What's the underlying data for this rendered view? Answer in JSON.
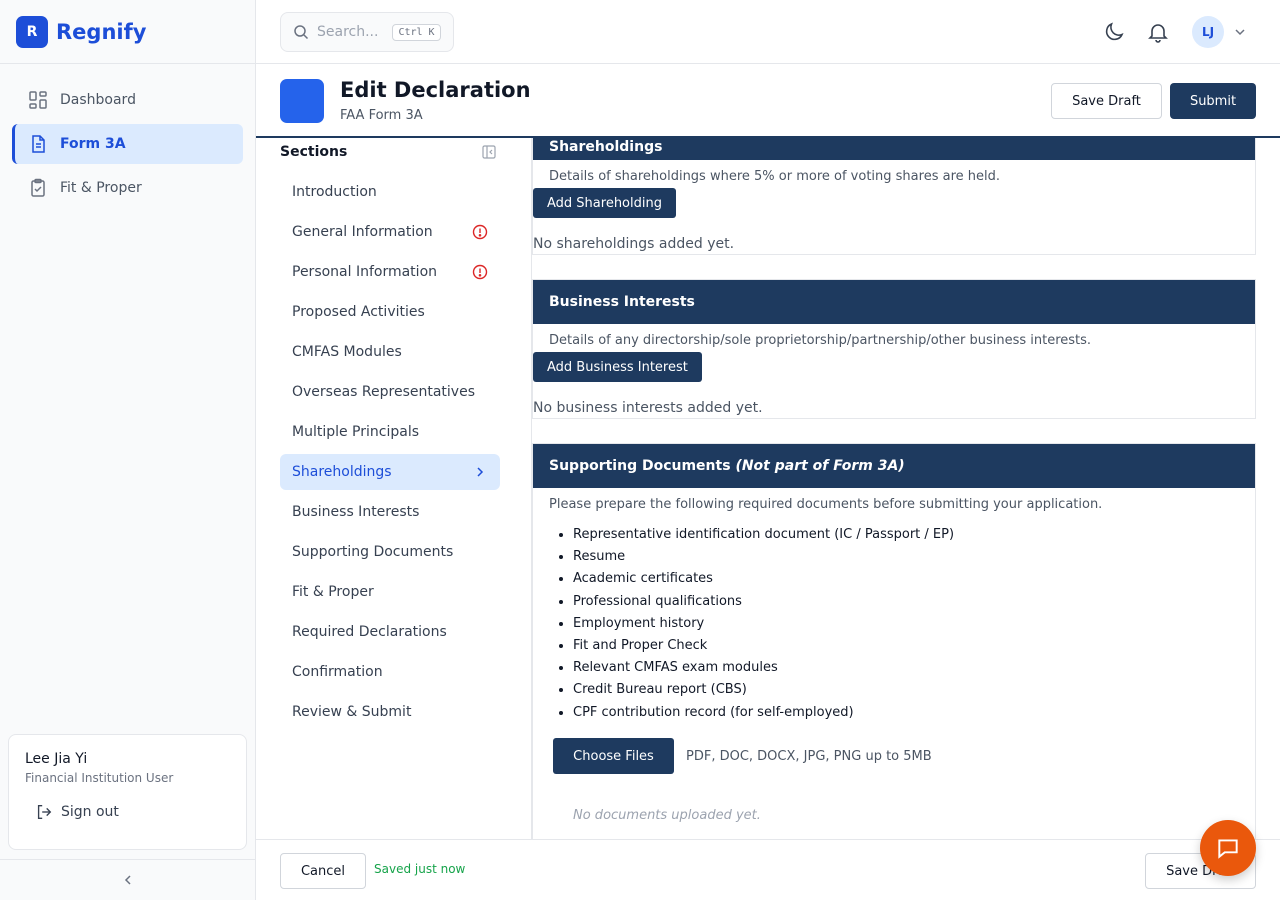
{
  "brand": {
    "logo_letter": "R",
    "name": "Regnify",
    "color": "#1d4ed8"
  },
  "nav": {
    "items": [
      {
        "label": "Dashboard",
        "icon": "dashboard-grid-icon",
        "active": false
      },
      {
        "label": "Form 3A",
        "icon": "document-icon",
        "active": true
      },
      {
        "label": "Fit & Proper",
        "icon": "clipboard-check-icon",
        "active": false
      }
    ]
  },
  "user": {
    "name": "Lee Jia Yi",
    "role": "Financial Institution User",
    "signout_label": "Sign out",
    "initials": "LJ"
  },
  "search": {
    "placeholder": "Search...",
    "shortcut": "Ctrl K"
  },
  "header": {
    "title": "Edit Declaration",
    "subtitle": "FAA Form 3A",
    "save_draft_label": "Save Draft",
    "submit_label": "Submit",
    "accent": "#1e3a5f"
  },
  "sections": {
    "title": "Sections",
    "items": [
      {
        "label": "Introduction",
        "status": ""
      },
      {
        "label": "General Information",
        "status": "error"
      },
      {
        "label": "Personal Information",
        "status": "error"
      },
      {
        "label": "Proposed Activities",
        "status": ""
      },
      {
        "label": "CMFAS Modules",
        "status": ""
      },
      {
        "label": "Overseas Representatives",
        "status": ""
      },
      {
        "label": "Multiple Principals",
        "status": ""
      },
      {
        "label": "Shareholdings",
        "status": "active"
      },
      {
        "label": "Business Interests",
        "status": ""
      },
      {
        "label": "Supporting Documents",
        "status": ""
      },
      {
        "label": "Fit & Proper",
        "status": ""
      },
      {
        "label": "Required Declarations",
        "status": ""
      },
      {
        "label": "Confirmation",
        "status": ""
      },
      {
        "label": "Review & Submit",
        "status": ""
      }
    ]
  },
  "shareholdings": {
    "title": "Shareholdings",
    "description": "Details of shareholdings where 5% or more of voting shares are held.",
    "add_label": "Add Shareholding",
    "empty_text": "No shareholdings added yet."
  },
  "business_interests": {
    "title": "Business Interests",
    "description": "Details of any directorship/sole proprietorship/partnership/other business interests.",
    "add_label": "Add Business Interest",
    "empty_text": "No business interests added yet."
  },
  "supporting_documents": {
    "title": "Supporting Documents",
    "title_note": "(Not part of Form 3A)",
    "description": "Please prepare the following required documents before submitting your application.",
    "documents": [
      "Representative identification document (IC / Passport / EP)",
      "Resume",
      "Academic certificates",
      "Professional qualifications",
      "Employment history",
      "Fit and Proper Check",
      "Relevant CMFAS exam modules",
      "Credit Bureau report (CBS)",
      "CPF contribution record (for self-employed)"
    ],
    "choose_label": "Choose Files",
    "upload_hint": "PDF, DOC, DOCX, JPG, PNG up to 5MB",
    "empty_text": "No documents uploaded yet."
  },
  "footer": {
    "cancel_label": "Cancel",
    "saved_text": "Saved just now",
    "save_draft_label": "Save Draft"
  },
  "colors": {
    "error": "#dc2626",
    "success": "#16a34a",
    "chat": "#ea580c",
    "active_bg": "#dbeafe"
  }
}
